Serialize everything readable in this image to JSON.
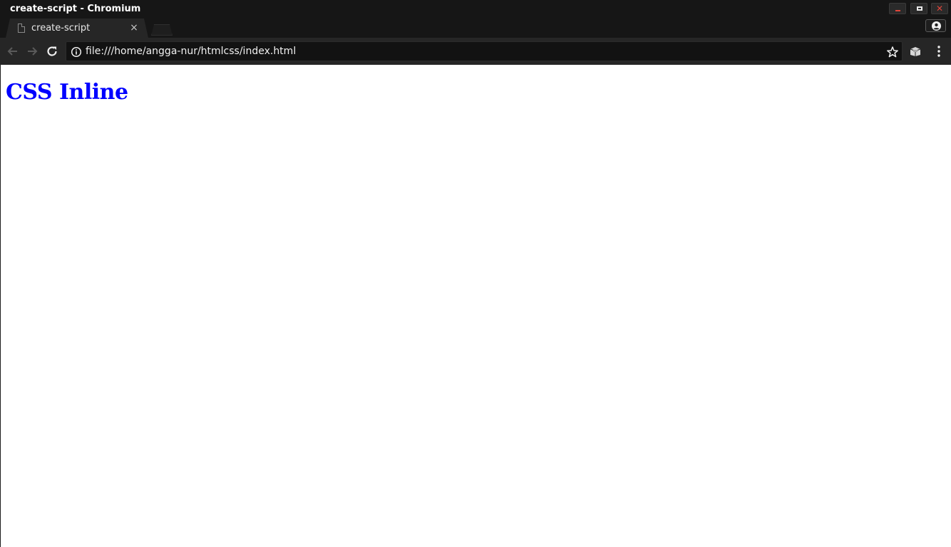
{
  "window": {
    "title": "create-script - Chromium",
    "controls": {
      "minimize_icon": "minimize-icon",
      "maximize_icon": "maximize-icon",
      "close_glyph": "✕"
    }
  },
  "tabs": [
    {
      "title": "create-script",
      "favicon": "page-icon",
      "close_glyph": "×"
    }
  ],
  "toolbar": {
    "back_icon": "arrow-left-icon",
    "forward_icon": "arrow-right-icon",
    "reload_icon": "reload-icon",
    "url": "file:///home/angga-nur/htmlcss/index.html",
    "info_icon": "info-icon",
    "bookmark_icon": "star-icon",
    "extension_icon": "extension-icon",
    "menu_icon": "kebab-menu-icon"
  },
  "page": {
    "heading": "CSS Inline",
    "heading_color": "#0000ff"
  },
  "colors": {
    "chrome_dark": "#161616",
    "toolbar": "#262626",
    "omnibox": "#121212",
    "close_accent": "#e0453a",
    "page_background": "#ffffff"
  }
}
